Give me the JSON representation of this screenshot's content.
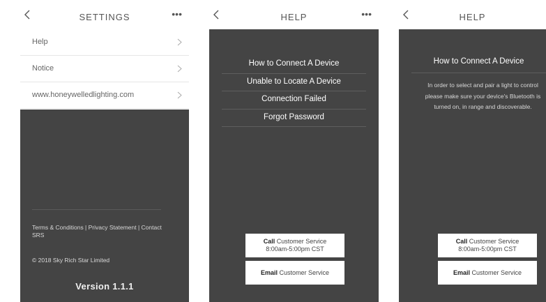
{
  "screen1": {
    "title": "SETTINGS",
    "more": "•••",
    "items": [
      {
        "label": "Help"
      },
      {
        "label": "Notice"
      },
      {
        "label": "www.honeywelledlighting.com"
      }
    ],
    "footer_links": "Terms & Conditions  |  Privacy Statement  |  Contact SRS",
    "copyright": "© 2018 Sky Rich Star Limited",
    "version": "Version 1.1.1"
  },
  "screen2": {
    "title": "HELP",
    "more": "•••",
    "topics": [
      {
        "label": "How to Connect A Device"
      },
      {
        "label": "Unable to Locate A Device"
      },
      {
        "label": "Connection Failed"
      },
      {
        "label": "Forgot Password"
      }
    ],
    "call_bold": "Call",
    "call_text": "Customer Service",
    "call_hours": "8:00am-5:00pm CST",
    "email_bold": "Email",
    "email_text": "Customer Service"
  },
  "screen3": {
    "title": "HELP",
    "heading": "How to Connect A Device",
    "body": "In order to select and pair a light to control please make sure your device's Bluetooth is turned on, in range and discoverable.",
    "call_bold": "Call",
    "call_text": "Customer Service",
    "call_hours": "8:00am-5:00pm CST",
    "email_bold": "Email",
    "email_text": "Customer Service"
  }
}
